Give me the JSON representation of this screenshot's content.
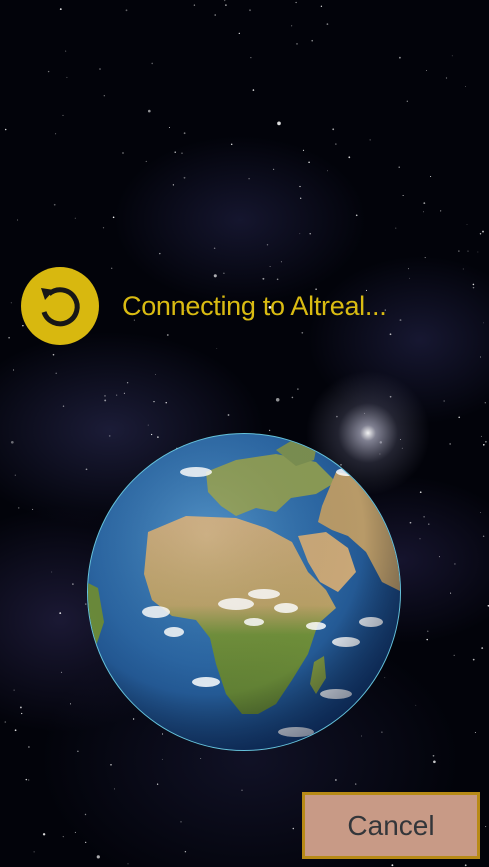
{
  "status": {
    "text": "Connecting to Altreal...",
    "spinner_icon": "refresh-icon",
    "accent_color": "#d9bb12"
  },
  "actions": {
    "cancel_label": "Cancel",
    "cancel_bg": "#c89a86",
    "cancel_border": "#b88a16"
  },
  "background": {
    "theme": "space",
    "globe_icon": "earth-globe"
  }
}
